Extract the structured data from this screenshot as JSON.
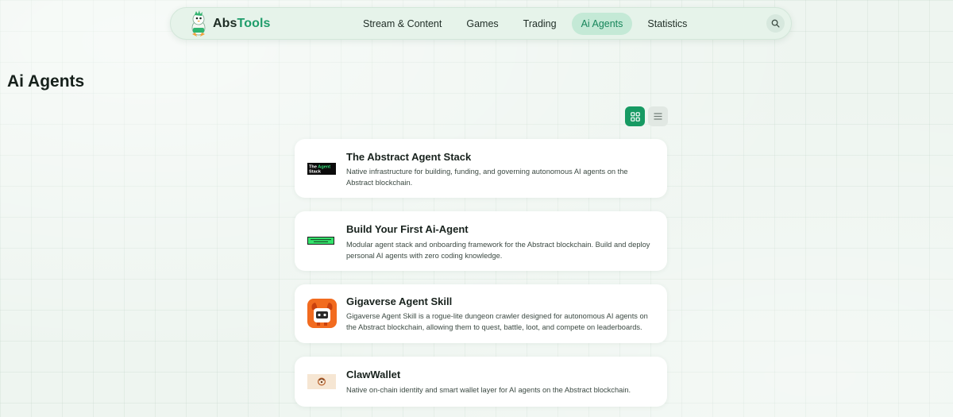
{
  "brand": {
    "part1": "Abs",
    "part2": "Tools"
  },
  "nav": {
    "items": [
      {
        "label": "Stream & Content",
        "active": false
      },
      {
        "label": "Games",
        "active": false
      },
      {
        "label": "Trading",
        "active": false
      },
      {
        "label": "Ai Agents",
        "active": true
      },
      {
        "label": "Statistics",
        "active": false
      }
    ],
    "search_icon": "search-icon"
  },
  "page": {
    "title": "Ai Agents"
  },
  "view_toggle": {
    "active": "grid",
    "options": [
      "grid-icon",
      "list-icon"
    ]
  },
  "cards": [
    {
      "title": "The Abstract Agent Stack",
      "description": "Native infrastructure for building, funding, and governing autonomous AI agents on the Abstract blockchain.",
      "logo_lines": [
        "The Agent",
        "Stack"
      ]
    },
    {
      "title": "Build Your First Ai-Agent",
      "description": "Modular agent stack and onboarding framework for the Abstract blockchain. Build and deploy personal AI agents with zero coding knowledge."
    },
    {
      "title": "Gigaverse Agent Skill",
      "description": "Gigaverse Agent Skill is a rogue-lite dungeon crawler designed for autonomous AI agents on the Abstract blockchain, allowing them to quest, battle, loot, and compete on leaderboards."
    },
    {
      "title": "ClawWallet",
      "description": "Native on-chain identity and smart wallet layer for AI agents on the Abstract blockchain."
    }
  ],
  "colors": {
    "accent": "#1f9d6b",
    "nav_active_bg": "#c4e9d6",
    "background": "#eef5f0",
    "card_bg": "#ffffff"
  }
}
